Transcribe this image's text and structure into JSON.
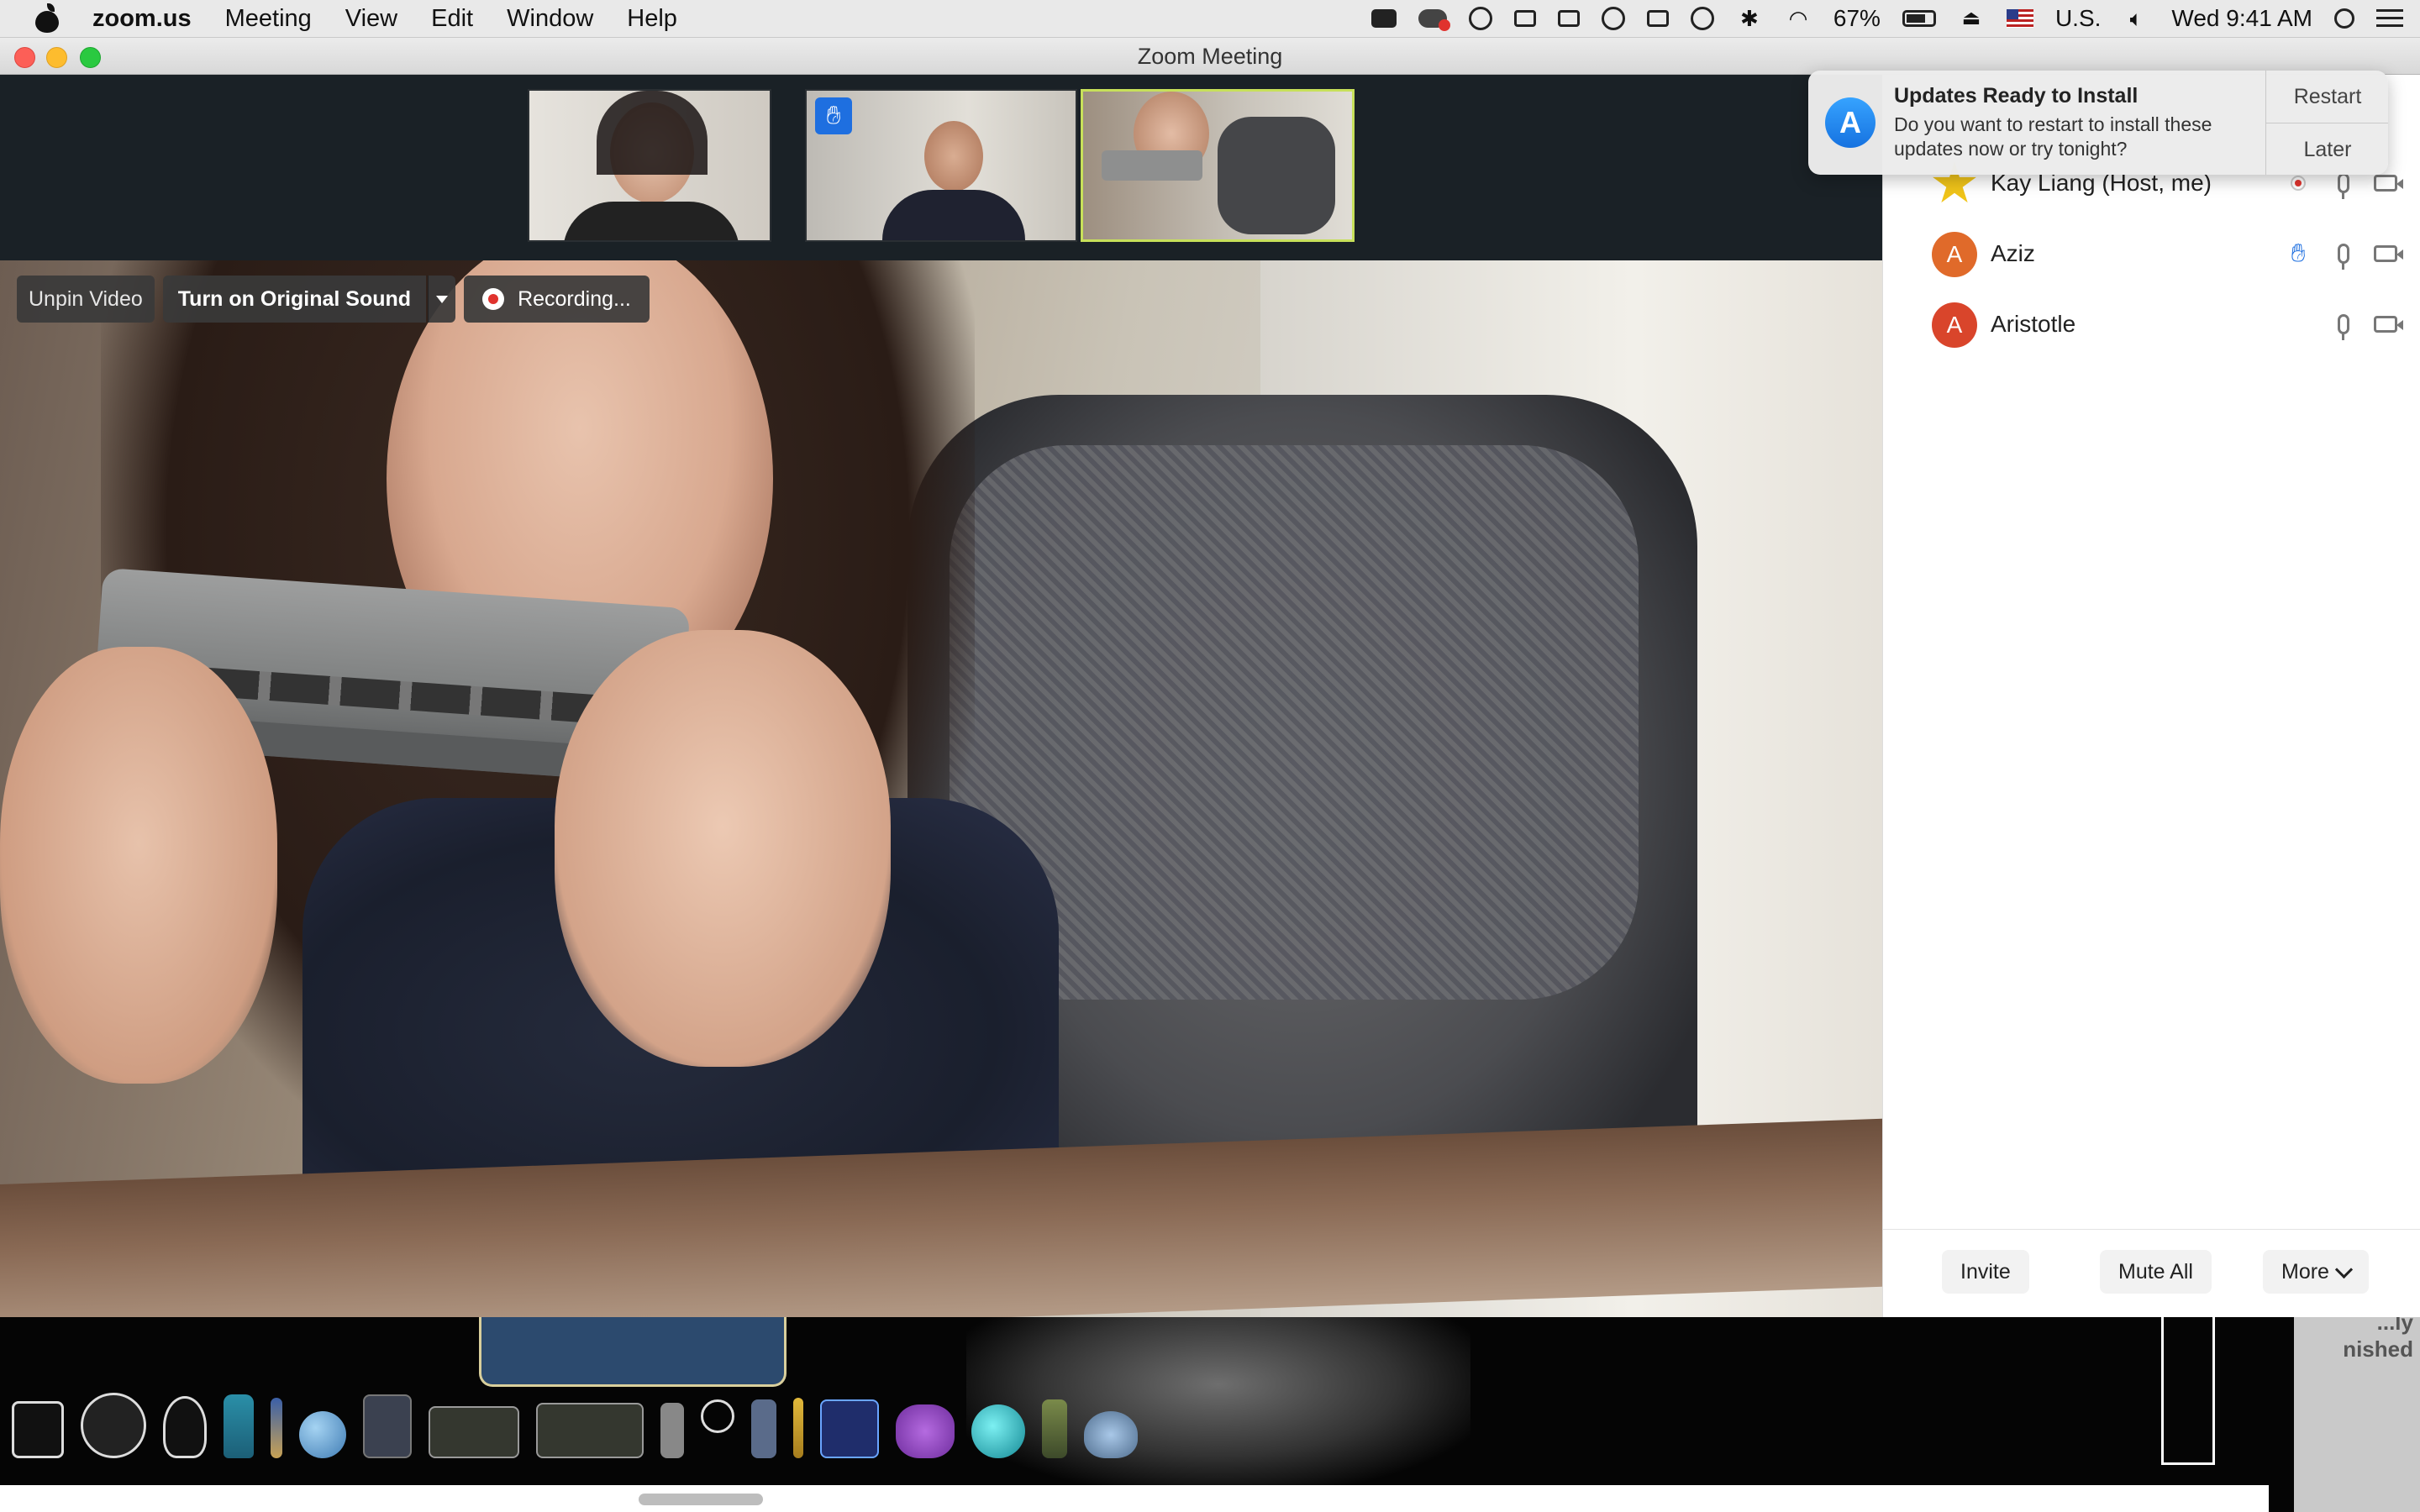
{
  "menubar": {
    "app_name": "zoom.us",
    "menus": [
      "Meeting",
      "View",
      "Edit",
      "Window",
      "Help"
    ],
    "battery_percent": "67%",
    "input_source": "U.S.",
    "clock": "Wed 9:41 AM"
  },
  "window": {
    "title": "Zoom Meeting"
  },
  "video_controls": {
    "unpin_label": "Unpin Video",
    "original_sound_label": "Turn on Original Sound",
    "recording_label": "Recording..."
  },
  "participants": [
    {
      "name": "Kay Liang (Host, me)",
      "avatar": "star",
      "recording": true,
      "hand_raised": false
    },
    {
      "name": "Aziz",
      "avatar_letter": "A",
      "avatar_color": "#e06a2a",
      "hand_raised": true
    },
    {
      "name": "Aristotle",
      "avatar_letter": "A",
      "avatar_color": "#d9452b",
      "hand_raised": false
    }
  ],
  "participants_footer": {
    "invite_label": "Invite",
    "mute_all_label": "Mute All",
    "more_label": "More"
  },
  "notification": {
    "title": "Updates Ready to Install",
    "body": "Do you want to restart to install these updates now or try tonight?",
    "restart_label": "Restart",
    "later_label": "Later"
  },
  "desktop": {
    "partial_text": "...ly\nnished"
  },
  "colors": {
    "accent_blue": "#1e6fe0",
    "active_speaker_border": "#c7e05a",
    "recording_red": "#e0332e"
  }
}
